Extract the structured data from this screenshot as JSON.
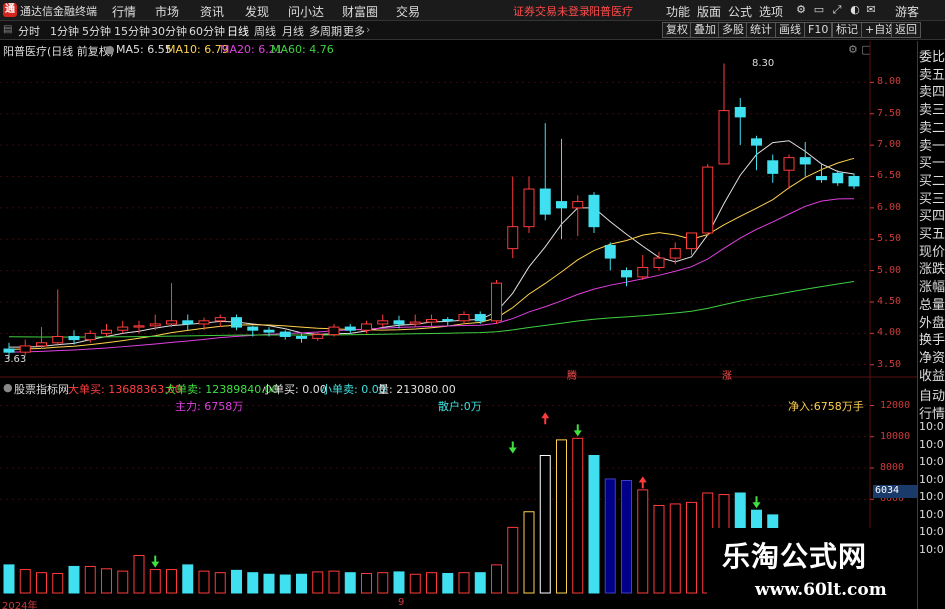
{
  "titlebar": {
    "app_name": "通达信金融终端",
    "menus": [
      "行情",
      "市场",
      "资讯",
      "发现",
      "问小达",
      "财富圈",
      "交易"
    ],
    "notice": "证券交易未登录",
    "stock": "阳普医疗",
    "right_menus": [
      "功能",
      "版面",
      "公式",
      "选项"
    ],
    "guest": "游客",
    "logo_char": "通"
  },
  "periodbar": {
    "tabs": [
      "分时",
      "1分钟",
      "5分钟",
      "15分钟",
      "30分钟",
      "60分钟",
      "日线",
      "周线",
      "月线",
      "多周期",
      "更多"
    ],
    "active": "日线",
    "tools": [
      "复权",
      "叠加",
      "多股",
      "统计",
      "画线",
      "F10",
      "标记",
      "+自选",
      "返回"
    ]
  },
  "main_chart": {
    "label": "阳普医疗(日线 前复权)",
    "ma": [
      {
        "name": "MA5",
        "value": "6.55",
        "color": "#e0e0e0"
      },
      {
        "name": "MA10",
        "value": "6.79",
        "color": "#ffd24d"
      },
      {
        "name": "MA20",
        "value": "6.21",
        "color": "#e040e0"
      },
      {
        "name": "MA60",
        "value": "4.76",
        "color": "#40d040"
      }
    ],
    "high_label": "8.30",
    "low_label": "3.63",
    "markers": [
      "腾",
      "涨"
    ],
    "y_ticks": [
      "8.00",
      "7.50",
      "7.00",
      "6.50",
      "6.00",
      "5.50",
      "5.00",
      "4.50",
      "4.00",
      "3.50"
    ]
  },
  "sub_chart": {
    "label": "股票指标网",
    "items": [
      {
        "text": "大单买: 13688363.00",
        "color": "#ff4040"
      },
      {
        "text": "大单卖: 12389840.00",
        "color": "#40e040"
      },
      {
        "text": "小单买: 0.00",
        "color": "#e0e0e0"
      },
      {
        "text": "小单卖: 0.00",
        "color": "#40e0e0"
      },
      {
        "text": "量: 213080.00",
        "color": "#e0e0e0"
      }
    ],
    "zhuli": "主力: 6758万",
    "sanhu": "散户:0万",
    "jingru": "净入:6758万手",
    "y_ticks": [
      "12000",
      "10000",
      "8000",
      "6000"
    ],
    "cursor_value": "6034",
    "x_labels": [
      "2024年",
      "9"
    ]
  },
  "side_panel": {
    "top": [
      "委比",
      "卖五",
      "卖四",
      "卖三",
      "卖二",
      "卖一",
      "买一",
      "买二",
      "买三",
      "买四",
      "买五",
      "现价",
      "涨跌",
      "涨幅",
      "总量",
      "外盘",
      "换手",
      "净资",
      "收益"
    ],
    "bottom": [
      "自动",
      "行情",
      "10:0",
      "10:0",
      "10:0",
      "10:0",
      "10:0",
      "10:0",
      "10:0",
      "10:0"
    ]
  },
  "watermark": {
    "title": "乐淘公式网",
    "url": "www.60lt.com"
  },
  "chart_data": {
    "type": "candlestick",
    "ylim": [
      3.4,
      8.5
    ],
    "candles": [
      [
        3.75,
        3.7,
        3.85,
        3.6
      ],
      [
        3.7,
        3.8,
        3.9,
        3.65
      ],
      [
        3.8,
        3.85,
        4.1,
        3.75
      ],
      [
        3.85,
        3.95,
        4.7,
        3.8
      ],
      [
        3.95,
        3.9,
        4.05,
        3.82
      ],
      [
        3.9,
        4.0,
        4.05,
        3.85
      ],
      [
        4.0,
        4.05,
        4.15,
        3.95
      ],
      [
        4.05,
        4.1,
        4.2,
        4.0
      ],
      [
        4.1,
        4.12,
        4.2,
        4.0
      ],
      [
        4.12,
        4.15,
        4.3,
        4.05
      ],
      [
        4.15,
        4.2,
        4.8,
        4.1
      ],
      [
        4.2,
        4.15,
        4.3,
        4.05
      ],
      [
        4.15,
        4.2,
        4.25,
        4.05
      ],
      [
        4.2,
        4.25,
        4.3,
        4.1
      ],
      [
        4.25,
        4.1,
        4.3,
        4.05
      ],
      [
        4.1,
        4.05,
        4.12,
        3.95
      ],
      [
        4.05,
        4.02,
        4.1,
        3.95
      ],
      [
        4.02,
        3.95,
        4.05,
        3.9
      ],
      [
        3.95,
        3.92,
        4.0,
        3.85
      ],
      [
        3.92,
        3.98,
        4.02,
        3.88
      ],
      [
        3.98,
        4.1,
        4.15,
        3.95
      ],
      [
        4.1,
        4.05,
        4.15,
        4.0
      ],
      [
        4.05,
        4.15,
        4.2,
        4.0
      ],
      [
        4.15,
        4.2,
        4.3,
        4.1
      ],
      [
        4.2,
        4.15,
        4.28,
        4.08
      ],
      [
        4.15,
        4.18,
        4.3,
        4.1
      ],
      [
        4.18,
        4.22,
        4.3,
        4.12
      ],
      [
        4.22,
        4.2,
        4.26,
        4.12
      ],
      [
        4.2,
        4.3,
        4.35,
        4.15
      ],
      [
        4.3,
        4.2,
        4.35,
        4.15
      ],
      [
        4.2,
        4.8,
        4.85,
        4.15
      ],
      [
        5.35,
        5.7,
        6.5,
        5.2
      ],
      [
        5.7,
        6.3,
        6.5,
        5.6
      ],
      [
        6.3,
        5.9,
        7.35,
        5.8
      ],
      [
        6.1,
        6.0,
        7.1,
        5.5
      ],
      [
        6.0,
        6.1,
        6.2,
        5.55
      ],
      [
        6.2,
        5.7,
        6.25,
        5.6
      ],
      [
        5.4,
        5.2,
        5.45,
        5.0
      ],
      [
        5.0,
        4.9,
        5.05,
        4.75
      ],
      [
        4.9,
        5.05,
        5.25,
        4.85
      ],
      [
        5.05,
        5.2,
        5.3,
        5.0
      ],
      [
        5.2,
        5.35,
        5.45,
        5.1
      ],
      [
        5.35,
        5.6,
        5.6,
        5.25
      ],
      [
        5.6,
        6.65,
        6.7,
        5.55
      ],
      [
        6.7,
        7.55,
        8.3,
        7.0
      ],
      [
        7.6,
        7.45,
        7.75,
        7.0
      ],
      [
        7.1,
        7.0,
        7.15,
        6.6
      ],
      [
        6.75,
        6.55,
        6.85,
        6.4
      ],
      [
        6.6,
        6.8,
        6.85,
        6.3
      ],
      [
        6.8,
        6.7,
        7.05,
        6.5
      ],
      [
        6.5,
        6.45,
        6.7,
        6.4
      ],
      [
        6.55,
        6.4,
        6.6,
        6.35
      ],
      [
        6.5,
        6.35,
        6.55,
        6.3
      ]
    ],
    "volume": [
      1800,
      1500,
      1300,
      1250,
      1700,
      1700,
      1550,
      1400,
      2400,
      1500,
      1500,
      1800,
      1400,
      1300,
      1450,
      1300,
      1200,
      1150,
      1200,
      1350,
      1400,
      1300,
      1250,
      1300,
      1350,
      1200,
      1300,
      1250,
      1300,
      1300,
      1800,
      4200,
      5200,
      8800,
      9800,
      9900,
      8800,
      7300,
      7200,
      6600,
      5600,
      5700,
      5800,
      6400,
      6300,
      6400,
      5300,
      5000
    ],
    "vol_ylim": [
      0,
      12800
    ]
  }
}
